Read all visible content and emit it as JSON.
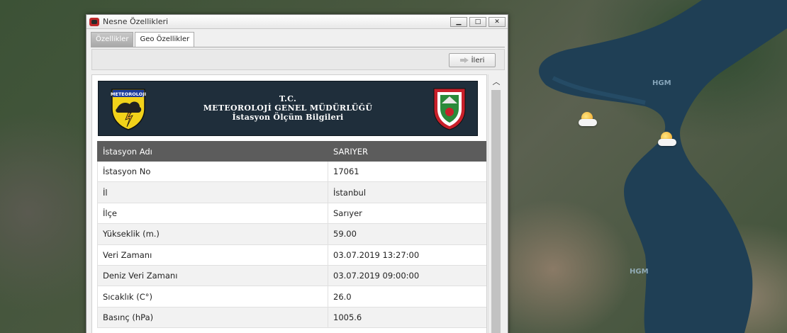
{
  "window": {
    "title": "Nesne Özellikleri",
    "minimize_glyph": "▁",
    "maximize_glyph": "□",
    "close_glyph": "✕"
  },
  "tabs": [
    {
      "label": "Özellikler",
      "active": true
    },
    {
      "label": "Geo Özellikler",
      "active": false
    }
  ],
  "toolbar": {
    "next_label": "İleri"
  },
  "banner": {
    "line1": "T.C.",
    "line2": "METEOROLOJİ GENEL MÜDÜRLÜĞÜ",
    "line3": "İstasyon Ölçüm Bilgileri",
    "logo_text": "METEOROLOJI"
  },
  "table": {
    "header": {
      "key": "İstasyon Adı",
      "value": "SARIYER"
    },
    "rows": [
      {
        "key": "İstasyon No",
        "value": "17061"
      },
      {
        "key": "İl",
        "value": "İstanbul"
      },
      {
        "key": "İlçe",
        "value": "Sarıyer"
      },
      {
        "key": "Yükseklik (m.)",
        "value": "59.00"
      },
      {
        "key": "Veri Zamanı",
        "value": "03.07.2019 13:27:00"
      },
      {
        "key": "Deniz Veri Zamanı",
        "value": "03.07.2019 09:00:00"
      },
      {
        "key": "Sıcaklık (C°)",
        "value": "26.0"
      },
      {
        "key": "Basınç (hPa)",
        "value": "1005.6"
      }
    ]
  },
  "map": {
    "labels": [
      "HGM",
      "HGM"
    ],
    "weather_icons": [
      "partly-cloudy-icon",
      "partly-cloudy-icon"
    ],
    "water_color": "#1f3f55"
  }
}
